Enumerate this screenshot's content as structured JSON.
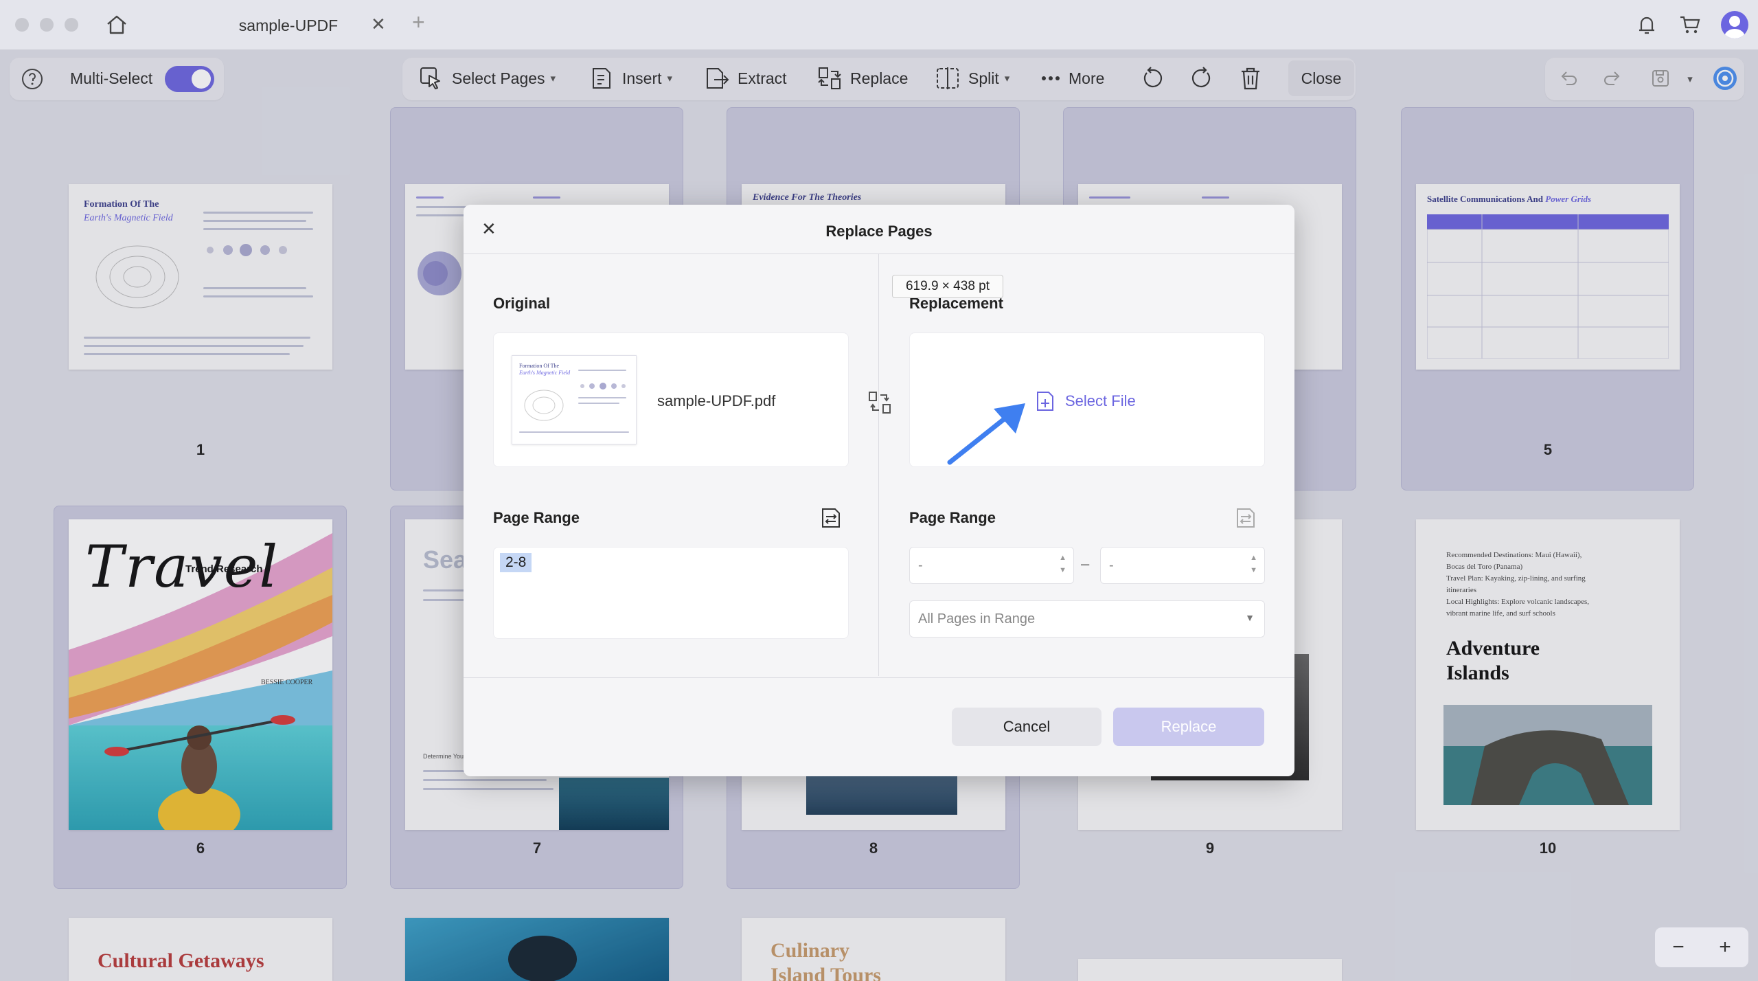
{
  "tab": {
    "title": "sample-UPDF",
    "close": "✕",
    "add": "+"
  },
  "toolbar": {
    "multi_select": "Multi-Select",
    "select_pages": "Select Pages",
    "insert": "Insert",
    "extract": "Extract",
    "replace": "Replace",
    "split": "Split",
    "more": "More",
    "close": "Close"
  },
  "pages": [
    {
      "num": "1",
      "title_a": "Formation Of The",
      "title_b": "Earth's Magnetic Field"
    },
    {
      "num": "5",
      "title_a": "Satellite Communications And",
      "title_b": "Power Grids"
    },
    {
      "num": "6",
      "title_a": "Trend Research",
      "title_b": "Travel",
      "author": "BESSIE COOPER"
    },
    {
      "num": "7",
      "title_a": "Sea",
      "sub": "Determine You"
    },
    {
      "num": "8",
      "title_a": "Evidence For The Theories"
    },
    {
      "num": "9"
    },
    {
      "num": "10",
      "title_a": "Adventure",
      "title_b": "Islands",
      "body": [
        "Recommended Destinations: Maui (Hawaii),",
        "Bocas del Toro (Panama)",
        "Travel Plan: Kayaking, zip-lining, and surfing",
        "itineraries",
        "Local Highlights: Explore volcanic landscapes,",
        "vibrant marine life, and surf schools"
      ]
    },
    {
      "title_a": "Cultural Getaways"
    },
    {
      "title_a": "Culinary",
      "title_b": "Island Tours"
    }
  ],
  "dialog": {
    "title": "Replace Pages",
    "close": "✕",
    "original_label": "Original",
    "replacement_label": "Replacement",
    "file_name": "sample-UPDF.pdf",
    "select_file": "Select File",
    "page_range_label": "Page Range",
    "range_value": "2-8",
    "from_placeholder": "-",
    "to_placeholder": "-",
    "range_sep": "–",
    "range_option": "All Pages in Range",
    "cancel": "Cancel",
    "replace": "Replace",
    "tooltip": "619.9 × 438 pt"
  },
  "zoom": {
    "minus": "−",
    "plus": "+"
  },
  "colors": {
    "accent": "#6b65e0",
    "arrow": "#3f7ff0"
  }
}
